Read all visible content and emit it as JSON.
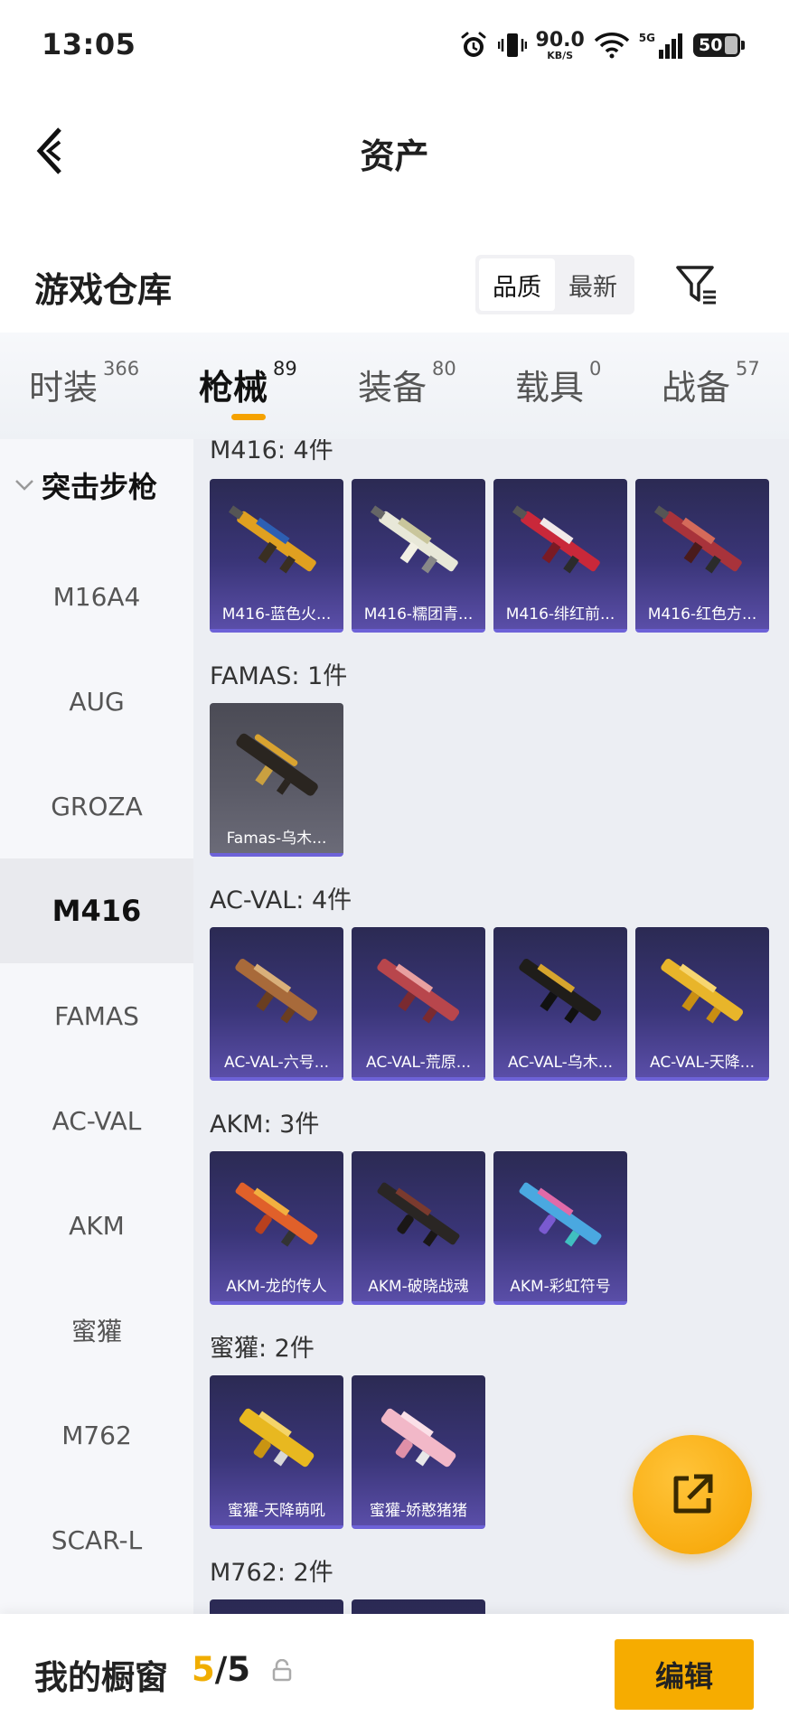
{
  "status_bar": {
    "time": "13:05",
    "net_speed_value": "90.0",
    "net_speed_unit": "KB/S",
    "network_tag": "5G",
    "battery_level": "50"
  },
  "header": {
    "title": "资产"
  },
  "section": {
    "title": "游戏仓库",
    "sort_options": [
      "品质",
      "最新"
    ],
    "sort_selected": "品质"
  },
  "tabs": [
    {
      "label": "时装",
      "count": "366"
    },
    {
      "label": "枪械",
      "count": "89"
    },
    {
      "label": "装备",
      "count": "80"
    },
    {
      "label": "载具",
      "count": "0"
    },
    {
      "label": "战备",
      "count": "57"
    }
  ],
  "active_tab": "枪械",
  "category": {
    "group": "突击步枪",
    "items": [
      "M16A4",
      "AUG",
      "GROZA",
      "M416",
      "FAMAS",
      "AC-VAL",
      "AKM",
      "蜜獾",
      "M762",
      "SCAR-L"
    ],
    "selected": "M416"
  },
  "groups": [
    {
      "title": "M416: 4件",
      "items": [
        "M416-蓝色火...",
        "M416-糯团青...",
        "M416-绯红前...",
        "M416-红色方..."
      ]
    },
    {
      "title": "FAMAS: 1件",
      "items": [
        "Famas-乌木..."
      ]
    },
    {
      "title": "AC-VAL: 4件",
      "items": [
        "AC-VAL-六号...",
        "AC-VAL-荒原...",
        "AC-VAL-乌木...",
        "AC-VAL-天降..."
      ]
    },
    {
      "title": "AKM: 3件",
      "items": [
        "AKM-龙的传人",
        "AKM-破晓战魂",
        "AKM-彩虹符号"
      ]
    },
    {
      "title": "蜜獾: 2件",
      "items": [
        "蜜獾-天降萌吼",
        "蜜獾-娇憨猪猪"
      ]
    },
    {
      "title": "M762: 2件",
      "items": []
    }
  ],
  "showcase": {
    "label": "我的橱窗",
    "count": "5",
    "total": "/5",
    "edit_label": "编辑"
  },
  "colors": {
    "accent": "#f6ac00",
    "card_purple": "#3a3578",
    "card_border": "#6d62d8"
  }
}
